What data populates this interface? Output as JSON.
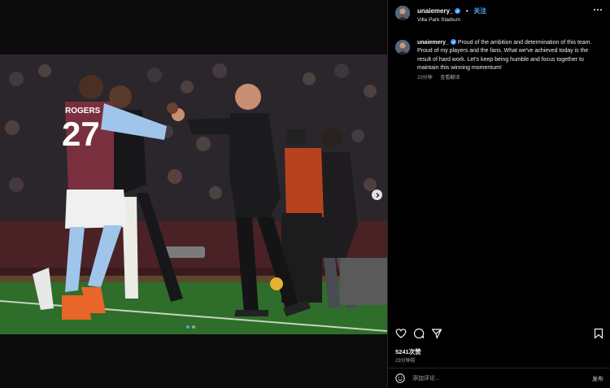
{
  "header": {
    "username": "unaiemery_",
    "separator": "•",
    "follow_label": "关注",
    "location": "Villa Park Stadium"
  },
  "caption": {
    "username": "unaiemery_",
    "text": "Proud of the ambition and determination of this team. Proud of my players and the fans. What we've achieved today is the result of hard work. Let's keep being humble and focus together to maintain this winning momentum!",
    "time": "23分钟",
    "translate_label": "查看翻译"
  },
  "media": {
    "player_name": "ROGERS",
    "player_number": "27",
    "slide_count": 2,
    "current_slide": 1
  },
  "actions": {
    "like_icon": "heart-icon",
    "comment_icon": "comment-icon",
    "share_icon": "share-icon",
    "save_icon": "bookmark-icon"
  },
  "likes": "5241次赞",
  "post_time": "23分钟前",
  "comment": {
    "placeholder": "添加评论...",
    "post_label": "发布",
    "emoji_icon": "emoji-icon"
  },
  "colors": {
    "accent": "#4aa0ff",
    "follow": "#5aa9ff",
    "background": "#000000",
    "claret": "#7a2f3f",
    "sky_blue": "#9fc6ea",
    "pitch": "#2f6d2b"
  }
}
